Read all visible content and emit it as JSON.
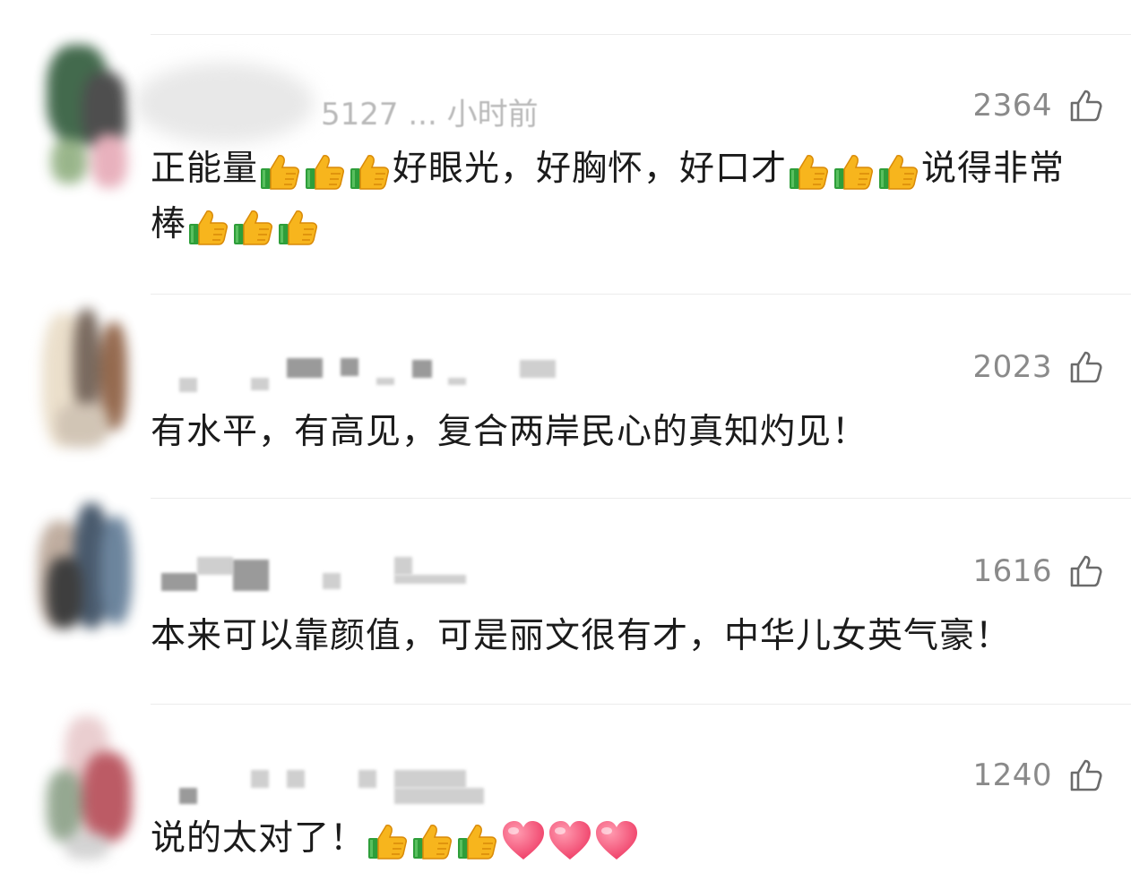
{
  "comments": [
    {
      "timestamp": "5127 ... 小时前",
      "likes": "2364",
      "segments": [
        {
          "t": "正能量"
        },
        {
          "e": "thumbs-up"
        },
        {
          "e": "thumbs-up"
        },
        {
          "e": "thumbs-up"
        },
        {
          "t": "好眼光，好胸怀，好口才"
        },
        {
          "e": "thumbs-up"
        },
        {
          "e": "thumbs-up"
        },
        {
          "e": "thumbs-up"
        },
        {
          "t": "说得非常棒"
        },
        {
          "e": "thumbs-up"
        },
        {
          "e": "thumbs-up"
        },
        {
          "e": "thumbs-up"
        }
      ]
    },
    {
      "likes": "2023",
      "segments": [
        {
          "t": "有水平，有高见，复合两岸民心的真知灼见！"
        }
      ]
    },
    {
      "likes": "1616",
      "segments": [
        {
          "t": "本来可以靠颜值，可是丽文很有才，中华儿女英气豪！"
        }
      ]
    },
    {
      "likes": "1240",
      "segments": [
        {
          "t": "说的太对了！"
        },
        {
          "e": "thumbs-up"
        },
        {
          "e": "thumbs-up"
        },
        {
          "e": "thumbs-up"
        },
        {
          "e": "heart"
        },
        {
          "e": "heart"
        },
        {
          "e": "heart"
        }
      ]
    }
  ],
  "colors": {
    "like_count": "#8a8a8a",
    "text": "#1b1b1b",
    "divider": "#ececec",
    "thumb_yellow": "#f7b51d",
    "thumb_cuff": "#2e9e3a",
    "heart": "#f0436b"
  }
}
